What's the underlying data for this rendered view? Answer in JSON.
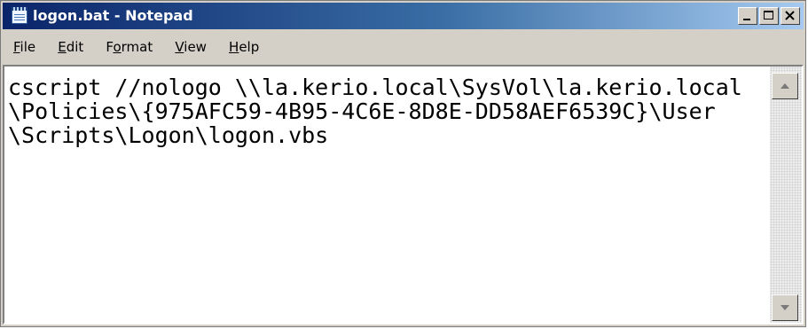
{
  "window": {
    "title": "logon.bat - Notepad"
  },
  "menu": [
    {
      "pre": "",
      "mn": "F",
      "post": "ile"
    },
    {
      "pre": "",
      "mn": "E",
      "post": "dit"
    },
    {
      "pre": "F",
      "mn": "o",
      "post": "rmat"
    },
    {
      "pre": "",
      "mn": "V",
      "post": "iew"
    },
    {
      "pre": "",
      "mn": "H",
      "post": "elp"
    }
  ],
  "editor": {
    "lines": [
      "cscript //nologo \\\\la.kerio.local\\SysVol\\la.kerio.local",
      "\\Policies\\{975AFC59-4B95-4C6E-8D8E-DD58AEF6539C}\\User",
      "\\Scripts\\Logon\\logon.vbs"
    ]
  },
  "icons": {
    "app": "notepad-icon",
    "minimize": "minimize-icon",
    "maximize": "maximize-icon",
    "close": "close-icon",
    "scroll_up": "scroll-up-arrow-icon",
    "scroll_down": "scroll-down-arrow-icon"
  }
}
